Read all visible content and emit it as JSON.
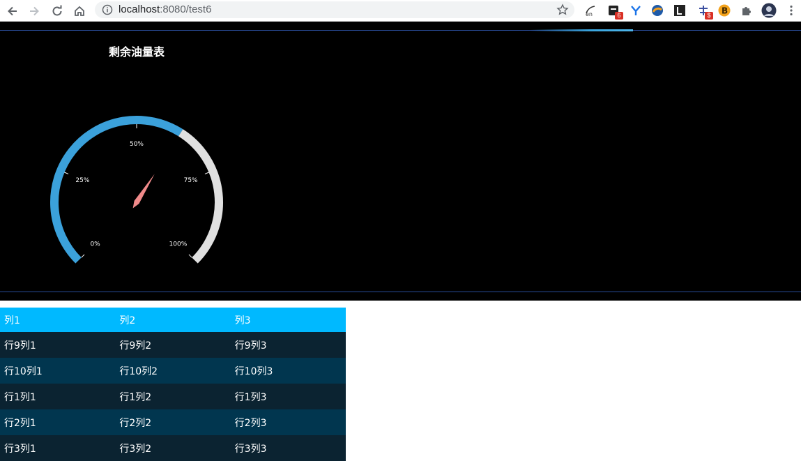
{
  "browser": {
    "url_host": "localhost",
    "url_rest": ":8080/test6",
    "extensions": [
      {
        "name": "translate-extension-icon",
        "badge": ""
      },
      {
        "name": "notes-extension-icon",
        "badge": "6"
      },
      {
        "name": "y-extension-icon",
        "badge": ""
      },
      {
        "name": "globe-extension-icon",
        "badge": ""
      },
      {
        "name": "l-extension-icon",
        "badge": ""
      },
      {
        "name": "chinese-extension-icon",
        "badge": "$"
      },
      {
        "name": "b-extension-icon",
        "badge": ""
      },
      {
        "name": "puzzle-icon",
        "badge": ""
      },
      {
        "name": "profile-avatar",
        "badge": ""
      }
    ]
  },
  "gauge": {
    "title": "剩余油量表",
    "value_percent": 62,
    "ticks": [
      "0%",
      "25%",
      "50%",
      "75%",
      "100%"
    ],
    "filled_color": "#3ba1db",
    "empty_color": "#e0e0e0",
    "pointer_color": "#f08a8a"
  },
  "table": {
    "headers": [
      "列1",
      "列2",
      "列3"
    ],
    "rows": [
      [
        "行9列1",
        "行9列2",
        "行9列3"
      ],
      [
        "行10列1",
        "行10列2",
        "行10列3"
      ],
      [
        "行1列1",
        "行1列2",
        "行1列3"
      ],
      [
        "行2列1",
        "行2列2",
        "行2列3"
      ],
      [
        "行3列1",
        "行3列2",
        "行3列3"
      ]
    ]
  },
  "colors": {
    "header_bg": "#00b9ff",
    "row_odd": "#0b2331",
    "row_even": "#01364f",
    "panel_bg": "#000000"
  }
}
